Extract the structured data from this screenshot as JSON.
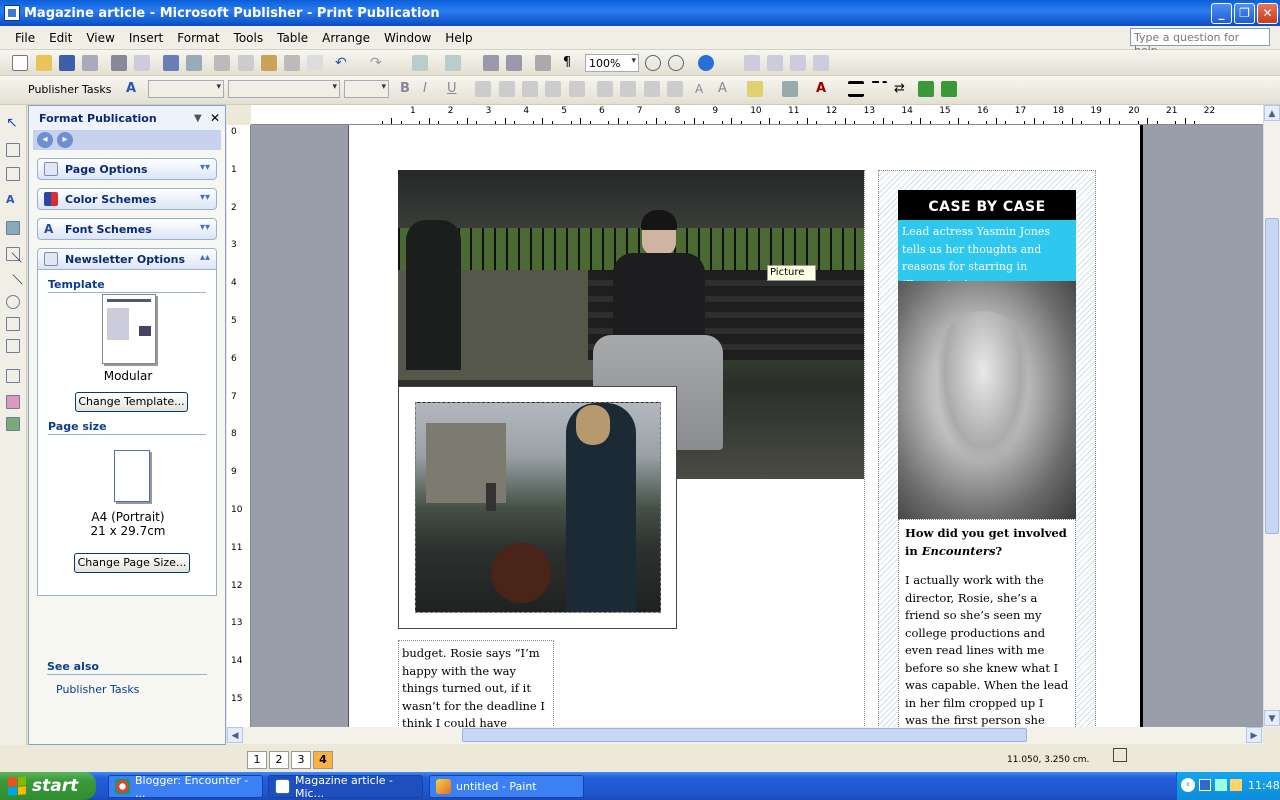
{
  "window": {
    "title": "Magazine article - Microsoft Publisher - Print Publication"
  },
  "menu": {
    "items": [
      "File",
      "Edit",
      "View",
      "Insert",
      "Format",
      "Tools",
      "Table",
      "Arrange",
      "Window",
      "Help"
    ],
    "help_placeholder": "Type a question for help"
  },
  "toolbar": {
    "zoom": "100%",
    "publisher_tasks": "Publisher Tasks"
  },
  "taskpane": {
    "title": "Format Publication",
    "sections": [
      "Page Options",
      "Color Schemes",
      "Font Schemes",
      "Newsletter Options"
    ],
    "template_heading": "Template",
    "template_name": "Modular",
    "change_template_label": "Change Template...",
    "page_size_heading": "Page size",
    "page_size_name": "A4 (Portrait)",
    "page_size_dims": "21 x 29.7cm",
    "change_page_size_label": "Change Page Size...",
    "see_also_heading": "See also",
    "see_also_link": "Publisher Tasks"
  },
  "ruler": {
    "h": [
      "1",
      "2",
      "3",
      "4",
      "5",
      "6",
      "7",
      "8",
      "9",
      "10",
      "11",
      "12",
      "13",
      "14",
      "15",
      "16",
      "17",
      "18",
      "19",
      "20",
      "21",
      "22"
    ],
    "v": [
      "0",
      "1",
      "2",
      "3",
      "4",
      "5",
      "6",
      "7",
      "8",
      "9",
      "10",
      "11",
      "12",
      "13",
      "14",
      "15"
    ]
  },
  "document": {
    "picture_tooltip": "Picture",
    "sidebar_title": "CASE BY CASE",
    "sidebar_intro": "Lead actress Yasmin Jones tells us her thoughts and reasons for starring in ‘Encounter’",
    "question_prefix": "How did you get involved in ",
    "question_italic": "Encounters",
    "question_suffix": "?",
    "answer": "I actually work with the director, Rosie, she’s a friend so she’s seen my college productions and even read lines with me before so she knew what I was capable. When the lead in her film cropped up I was the first person she asked and I jumped at the chance to be in",
    "body_text": "budget. Rosie says “I’m happy with the way things turned out, if it wasn’t for the deadline I think I could have improved it a little but"
  },
  "status": {
    "pages": [
      "1",
      "2",
      "3",
      "4"
    ],
    "active_page": "4",
    "coords": "11.050, 3.250 cm."
  },
  "taskbar": {
    "start_label": "start",
    "tasks": [
      "Blogger: Encounter - ...",
      "Magazine article - Mic...",
      "untitled - Paint"
    ],
    "clock": "11:48"
  }
}
